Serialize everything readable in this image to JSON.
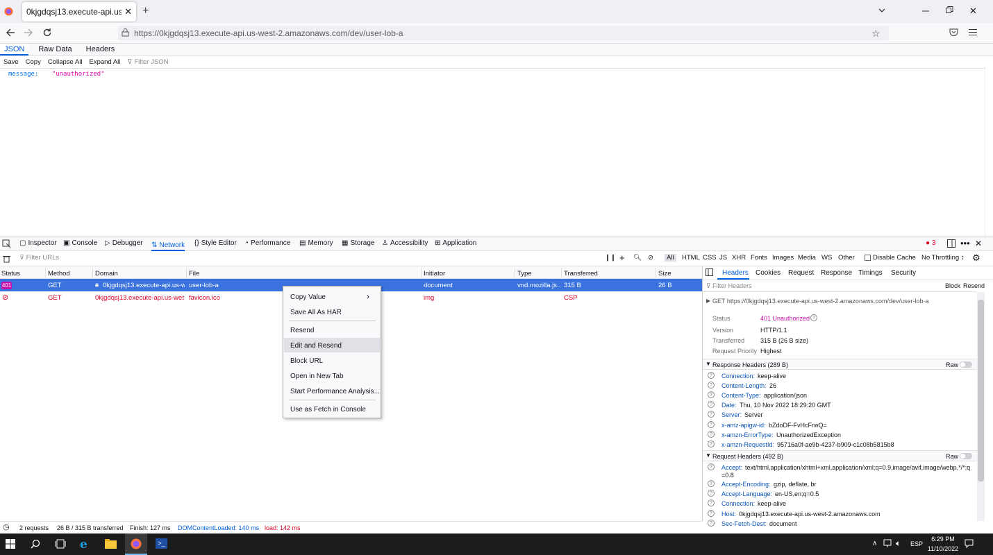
{
  "browser": {
    "tab_title": "0kjgdqsj13.execute-api.us-west-2.ar",
    "url": "https://0kjgdqsj13.execute-api.us-west-2.amazonaws.com/dev/user-lob-a"
  },
  "json_viewer": {
    "tabs": [
      "JSON",
      "Raw Data",
      "Headers"
    ],
    "toolbar": [
      "Save",
      "Copy",
      "Collapse All",
      "Expand All"
    ],
    "filter_placeholder": "Filter JSON",
    "key": "message:",
    "value": "\"unauthorized\""
  },
  "devtools": {
    "tabs": [
      "Inspector",
      "Console",
      "Debugger",
      "Network",
      "Style Editor",
      "Performance",
      "Memory",
      "Storage",
      "Accessibility",
      "Application"
    ],
    "error_count": "3",
    "filter_placeholder": "Filter URLs",
    "type_filters": [
      "All",
      "HTML",
      "CSS",
      "JS",
      "XHR",
      "Fonts",
      "Images",
      "Media",
      "WS",
      "Other"
    ],
    "disable_cache": "Disable Cache",
    "throttling": "No Throttling ↕"
  },
  "network": {
    "columns": [
      "Status",
      "Method",
      "Domain",
      "File",
      "Initiator",
      "Type",
      "Transferred",
      "Size"
    ],
    "rows": [
      {
        "status": "401",
        "method": "GET",
        "domain": "0kjgdqsj13.execute-api.us-w...",
        "file": "user-lob-a",
        "initiator": "document",
        "type": "vnd.mozilla.js...",
        "transferred": "315 B",
        "size": "26 B"
      },
      {
        "status": "",
        "method": "GET",
        "domain": "0kjgdqsj13.execute-api.us-west...",
        "file": "favicon.ico",
        "initiator": "img",
        "type": "",
        "transferred": "CSP",
        "size": ""
      }
    ],
    "summary": {
      "requests": "2 requests",
      "bytes": "26 B / 315 B transferred",
      "finish": "Finish: 127 ms",
      "dcl": "DOMContentLoaded: 140 ms",
      "load": "load: 142 ms"
    }
  },
  "context_menu": {
    "items": [
      "Copy Value",
      "Save All As HAR",
      "Resend",
      "Edit and Resend",
      "Block URL",
      "Open in New Tab",
      "Start Performance Analysis...",
      "Use as Fetch in Console"
    ]
  },
  "side_panel": {
    "tabs": [
      "Headers",
      "Cookies",
      "Request",
      "Response",
      "Timings",
      "Security"
    ],
    "filter_placeholder": "Filter Headers",
    "block": "Block",
    "resend": "Resend",
    "request_line": "GET https://0kjgdqsj13.execute-api.us-west-2.amazonaws.com/dev/user-lob-a",
    "summary": [
      {
        "label": "Status",
        "value": "401 Unauthorized"
      },
      {
        "label": "Version",
        "value": "HTTP/1.1"
      },
      {
        "label": "Transferred",
        "value": "315 B (26 B size)"
      },
      {
        "label": "Request Priority",
        "value": "Highest"
      }
    ],
    "response_title": "Response Headers (289 B)",
    "raw": "Raw",
    "response_headers": [
      {
        "k": "Connection:",
        "v": "keep-alive"
      },
      {
        "k": "Content-Length:",
        "v": "26"
      },
      {
        "k": "Content-Type:",
        "v": "application/json"
      },
      {
        "k": "Date:",
        "v": "Thu, 10 Nov 2022 18:29:20 GMT"
      },
      {
        "k": "Server:",
        "v": "Server"
      },
      {
        "k": "x-amz-apigw-id:",
        "v": "bZdoDF-FvHcFrwQ="
      },
      {
        "k": "x-amzn-ErrorType:",
        "v": "UnauthorizedException"
      },
      {
        "k": "x-amzn-RequestId:",
        "v": "95716a0f-ae9b-4237-b909-c1c08b5815b8"
      }
    ],
    "request_title": "Request Headers (492 B)",
    "request_headers": [
      {
        "k": "Accept:",
        "v": "text/html,application/xhtml+xml,application/xml;q=0.9,image/avif,image/webp,*/*;q"
      },
      {
        "k": "",
        "v": "=0.8"
      },
      {
        "k": "Accept-Encoding:",
        "v": "gzip, deflate, br"
      },
      {
        "k": "Accept-Language:",
        "v": "en-US,en;q=0.5"
      },
      {
        "k": "Connection:",
        "v": "keep-alive"
      },
      {
        "k": "Host:",
        "v": "0kjgdqsj13.execute-api.us-west-2.amazonaws.com"
      },
      {
        "k": "Sec-Fetch-Dest:",
        "v": "document"
      }
    ]
  },
  "taskbar": {
    "lang": "ESP",
    "time": "6:29 PM",
    "date": "11/10/2022"
  }
}
